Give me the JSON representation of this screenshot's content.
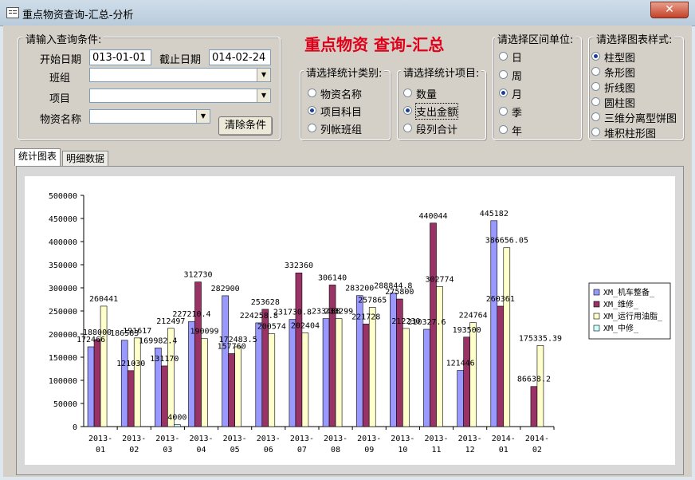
{
  "window": {
    "title": "重点物资查询-汇总-分析",
    "close_label": "✕"
  },
  "query": {
    "legend": "请输入查询条件:",
    "start_label": "开始日期",
    "start_value": "013-01-01",
    "end_label": "截止日期",
    "end_value": "014-02-24",
    "team_label": "班组",
    "item_label": "项目",
    "material_label": "物资名称",
    "clear_button": "清除条件"
  },
  "header": {
    "title": "重点物资  查询-汇总"
  },
  "stat_type": {
    "legend": "请选择统计类别:",
    "options": [
      "物资名称",
      "项目科目",
      "列帐班组"
    ],
    "selected": 1
  },
  "stat_item": {
    "legend": "请选择统计项目:",
    "options": [
      "数量",
      "支出金额",
      "段列合计"
    ],
    "selected": 1
  },
  "interval": {
    "legend": "请选择区间单位:",
    "options": [
      "日",
      "周",
      "月",
      "季",
      "年"
    ],
    "selected": 2
  },
  "chart_style": {
    "legend": "请选择图表样式:",
    "options": [
      "柱型图",
      "条形图",
      "折线图",
      "圆柱图",
      "三维分离型饼图",
      "堆积柱形图"
    ],
    "selected": 0
  },
  "tabs": [
    "统计图表",
    "明细数据"
  ],
  "colors": {
    "series": [
      "#9999ff",
      "#993366",
      "#ffffcc",
      "#ccffff"
    ]
  },
  "chart_data": {
    "type": "bar",
    "categories": [
      "2013-01",
      "2013-02",
      "2013-03",
      "2013-04",
      "2013-05",
      "2013-06",
      "2013-07",
      "2013-08",
      "2013-09",
      "2013-10",
      "2013-11",
      "2013-12",
      "2014-01",
      "2014-02"
    ],
    "ylim": [
      0,
      500000
    ],
    "yticks": [
      0,
      50000,
      100000,
      150000,
      200000,
      250000,
      300000,
      350000,
      400000,
      450000,
      500000
    ],
    "legend_position": "right",
    "series": [
      {
        "name": "XM_机车整备_",
        "values": [
          172466,
          186583,
          169982.4,
          227210.4,
          282900,
          224258.8,
          231730.8,
          233488,
          283200,
          288844.8,
          210327.6,
          121446,
          445182,
          null
        ],
        "labels": [
          "172466",
          "186583",
          "169982.4",
          "227210.4",
          "282900",
          "224258.8",
          "231730.8",
          "233488",
          "283200",
          "288844.8",
          "210327.6",
          "121446",
          "445182",
          ""
        ]
      },
      {
        "name": "XM_维修_",
        "values": [
          188000,
          121030,
          131170,
          312730,
          157760,
          253628,
          332360,
          306140,
          221728,
          275800,
          440044,
          193500,
          260361,
          86638.2
        ],
        "labels": [
          "188000",
          "121030",
          "131170",
          "312730",
          "157760",
          "253628",
          "332360",
          "306140",
          "221728",
          "275800",
          "440044",
          "193500",
          "260361",
          "86638.2"
        ]
      },
      {
        "name": "XM_运行用油脂_",
        "values": [
          260441,
          191617,
          212497,
          190099,
          172483.5,
          200574,
          202404,
          233299,
          257865,
          212230,
          302774,
          224764,
          386656.05,
          175335.39
        ],
        "labels": [
          "260441",
          "191617",
          "212497",
          "190099",
          "172483.5",
          "200574",
          "202404",
          "233299",
          "257865",
          "212230",
          "302774",
          "224764",
          "386656.05",
          "175335.39"
        ]
      },
      {
        "name": "XM_中修_",
        "values": [
          null,
          null,
          4000,
          null,
          null,
          null,
          null,
          null,
          null,
          null,
          null,
          null,
          null,
          null
        ],
        "labels": [
          "",
          "",
          "4000",
          "",
          "",
          "",
          "",
          "",
          "",
          "",
          "",
          "",
          "",
          ""
        ]
      }
    ]
  }
}
